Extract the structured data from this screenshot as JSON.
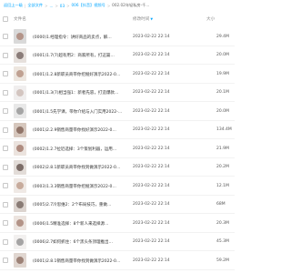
{
  "breadcrumb": [
    {
      "label": "返回上一级"
    },
    {
      "label": "全部文件"
    },
    {
      "label": "..."
    },
    {
      "label": "03"
    },
    {
      "label": "006【抖音】视频号"
    },
    {
      "label": "002.02年轻私房-千..."
    }
  ],
  "header": {
    "name_label": "文件名",
    "date_label": "修改时间",
    "size_label": "大小"
  },
  "files": [
    {
      "name": "(0000)1.经理指令：讲好商品的卖点，解…",
      "date": "2023-02-22 22:14",
      "size": "29.4M",
      "thumb_a": "#d9d9d9",
      "thumb_b": "#a67c6d"
    },
    {
      "name": "(0001)1.7(7)超有用2：商家所有，打这篇…",
      "date": "2023-02-22 22:14",
      "size": "20.0M",
      "thumb_a": "#e6e0dc",
      "thumb_b": "#6b5b58"
    },
    {
      "name": "(0001)1.2.8新职员商带你挖掘好演示2022-0…",
      "date": "2023-02-22 22:14",
      "size": "19.9M",
      "thumb_a": "#ede6df",
      "thumb_b": "#b08a78"
    },
    {
      "name": "(0001)1.3(7)相当强1：新者先容，打造爆款…",
      "date": "2023-02-22 22:14",
      "size": "20.1M",
      "thumb_a": "#f0eeee",
      "thumb_b": "#c9b7b0"
    },
    {
      "name": "(0001)1.5先学课，带你介绍与入门实用2022-…",
      "date": "2023-02-22 22:14",
      "size": "20.0M",
      "thumb_a": "#e8e8e8",
      "thumb_b": "#8f8f8f"
    },
    {
      "name": "(0001)2.2.9销售商量带你找好演示2022-0…",
      "date": "2023-02-22 22:14",
      "size": "134.4M",
      "thumb_a": "#d6c7bd",
      "thumb_b": "#7a5a4e"
    },
    {
      "name": "(0002)1.2.7拉近选择：3个策划利器，运用…",
      "date": "2023-02-22 22:14",
      "size": "21.9M",
      "thumb_a": "#ebe3de",
      "thumb_b": "#9b6f60"
    },
    {
      "name": "(0002)2.8.1新职员商带你找到做演示2022-0…",
      "date": "2023-02-22 22:14",
      "size": "20.2M",
      "thumb_a": "#e2dcd8",
      "thumb_b": "#5a4843"
    },
    {
      "name": "(0003)1.3.3销售商量带你挖掘演示2022-0…",
      "date": "2023-02-22 22:14",
      "size": "12.1M",
      "thumb_a": "#efe9e5",
      "thumb_b": "#b99583"
    },
    {
      "name": "(0005)2.7冷思维2：2个布局技巧，重做…",
      "date": "2023-02-22 22:14",
      "size": "68M",
      "thumb_a": "#dcd4cf",
      "thumb_b": "#6e5d57"
    },
    {
      "name": "(0006)1.5精准选择：8个新人来选择源…",
      "date": "2023-02-22 22:14",
      "size": "20.3M",
      "thumb_a": "#ece4df",
      "thumb_b": "#a0786a"
    },
    {
      "name": "(0006)2.7如何抓住：6个黑头条顶理推出…",
      "date": "2023-02-22 22:14",
      "size": "45.3M",
      "thumb_a": "#f2f0ef",
      "thumb_b": "#8b8b8b"
    },
    {
      "name": "(0001)2.8.1销售商量带你找到做演示2022-0…",
      "date": "2023-02-22 22:14",
      "size": "59.2M",
      "thumb_a": "#e0d6d0",
      "thumb_b": "#87655a"
    }
  ],
  "colors": {
    "accent": "#06a7ff"
  }
}
